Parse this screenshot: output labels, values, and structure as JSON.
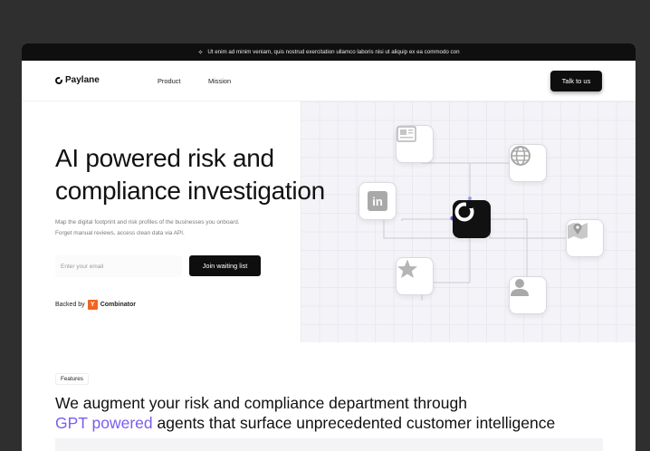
{
  "announcement": {
    "text": "Ut enim ad minim veniam, quis nostrud exercitation ullamco laboris nisi ut aliquip ex ea commodo con",
    "icon": "sparkle-icon"
  },
  "nav": {
    "brand": "Paylane",
    "links": [
      "Product",
      "Mission"
    ],
    "cta": "Talk to us"
  },
  "hero": {
    "title_line1": "AI powered risk and",
    "title_line2": "compliance investigation",
    "subtitle_line1": "Map the digital footprint and risk profiles of the businesses you onboard.",
    "subtitle_line2": "Forget manual reviews, access clean data via API.",
    "email_placeholder": "Enter your email",
    "join_label": "Join waiting list",
    "backed_by": "Backed by",
    "yc_letter": "Y",
    "yc_name": "Combinator"
  },
  "graphic": {
    "nodes": [
      "news-icon",
      "globe-icon",
      "linkedin-icon",
      "paylane-icon",
      "map-icon",
      "star-icon",
      "person-icon"
    ],
    "linkedin_text": "in",
    "accent_color": "#6d6df5"
  },
  "features": {
    "badge": "Features",
    "heading_line1": "We augment your risk and compliance department through",
    "heading_accent": "GPT powered",
    "heading_rest": " agents that surface unprecedented customer intelligence",
    "accent_color": "#7b5cf0"
  }
}
